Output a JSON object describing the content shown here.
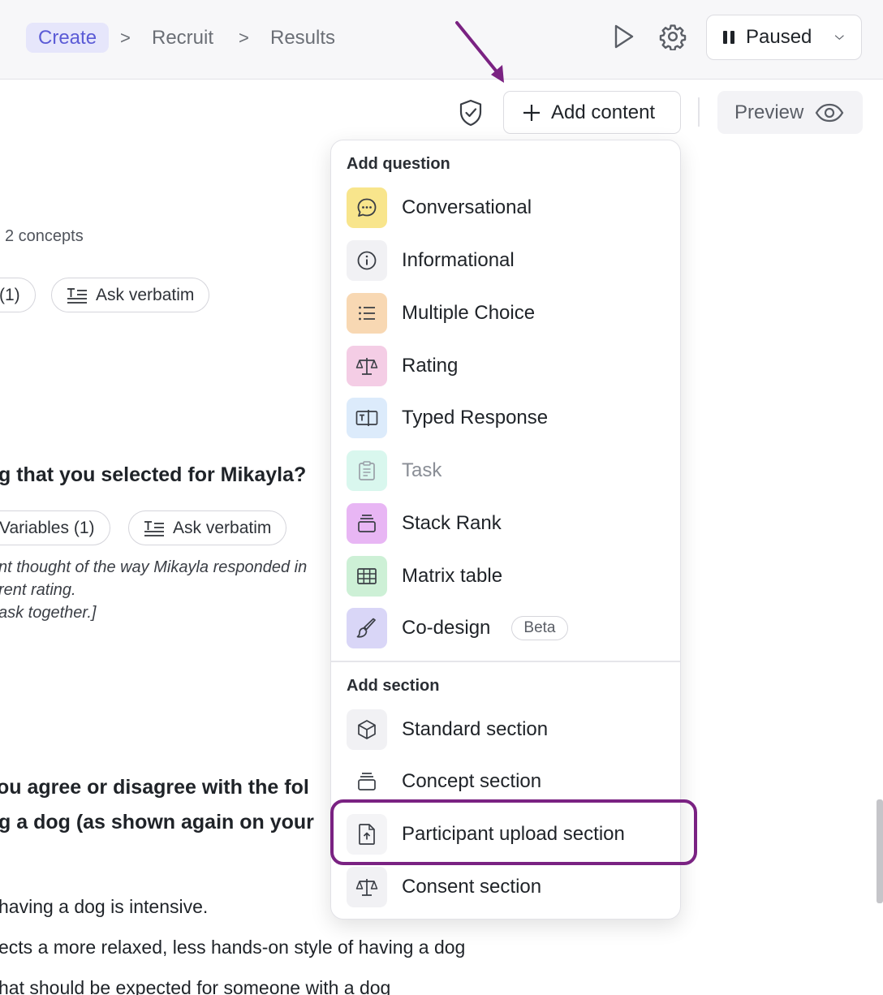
{
  "nav": {
    "breadcrumbs": [
      "Create",
      "Recruit",
      "Results"
    ],
    "separator": ">",
    "status_label": "Paused"
  },
  "toolbar": {
    "add_content_label": "Add content",
    "preview_label": "Preview"
  },
  "background": {
    "concepts_text": "2 concepts",
    "pill_count": "(1)",
    "ask_verbatim_label": "Ask verbatim",
    "question_2_title": "g that you selected for Mikayla?",
    "variables_pill": "Variables (1)",
    "instructions": [
      "nt thought of the way Mikayla responded in",
      "rent rating.",
      "ask together.]"
    ],
    "question_3_lines": [
      "ou agree or disagree with the fol",
      "g a dog (as shown again on your"
    ],
    "statements": [
      "having a dog is intensive.",
      "ects a more relaxed, less hands-on style of having a dog",
      "hat should be expected for someone with a dog"
    ]
  },
  "menu": {
    "question_heading": "Add question",
    "questions": [
      {
        "label": "Conversational",
        "icon": "chat-bubble-icon",
        "bg": "#f8e58c"
      },
      {
        "label": "Informational",
        "icon": "info-icon",
        "bg": "#f1f1f4"
      },
      {
        "label": "Multiple Choice",
        "icon": "list-icon",
        "bg": "#f8d8b3"
      },
      {
        "label": "Rating",
        "icon": "scale-icon",
        "bg": "#f4cde5"
      },
      {
        "label": "Typed Response",
        "icon": "text-field-icon",
        "bg": "#dcebfb"
      },
      {
        "label": "Task",
        "icon": "clipboard-icon",
        "bg": "#d9f7ee"
      },
      {
        "label": "Stack Rank",
        "icon": "stack-icon",
        "bg": "#e8b6f4"
      },
      {
        "label": "Matrix table",
        "icon": "grid-icon",
        "bg": "#cdf0d6"
      },
      {
        "label": "Co-design",
        "icon": "brush-icon",
        "bg": "#d9d6f7"
      }
    ],
    "beta_badge": "Beta",
    "section_heading": "Add section",
    "sections": [
      {
        "label": "Standard section",
        "icon": "cube-icon"
      },
      {
        "label": "Concept section",
        "icon": "stack-icon"
      },
      {
        "label": "Participant upload section",
        "icon": "file-upload-icon"
      },
      {
        "label": "Consent section",
        "icon": "scale-icon"
      }
    ]
  },
  "colors": {
    "accent": "#5b5bd6",
    "annotation": "#7a2282"
  }
}
